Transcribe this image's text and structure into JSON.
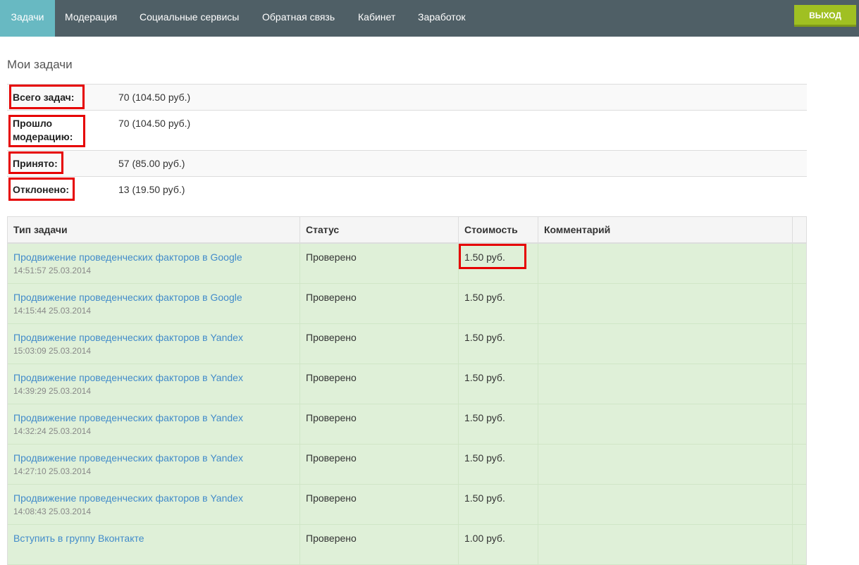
{
  "nav": {
    "items": [
      {
        "label": "Задачи",
        "active": true
      },
      {
        "label": "Модерация",
        "active": false
      },
      {
        "label": "Социальные сервисы",
        "active": false
      },
      {
        "label": "Обратная связь",
        "active": false
      },
      {
        "label": "Кабинет",
        "active": false
      },
      {
        "label": "Заработок",
        "active": false
      }
    ],
    "logout_label": "Выход"
  },
  "page": {
    "title": "Мои задачи"
  },
  "summary": {
    "total": {
      "label": "Всего задач:",
      "value": "70 (104.50 руб.)"
    },
    "moderated": {
      "label": "Прошло модерацию:",
      "value": "70 (104.50 руб.)"
    },
    "accepted": {
      "label": "Принято:",
      "value": "57 (85.00 руб.)"
    },
    "rejected": {
      "label": "Отклонено:",
      "value": "13 (19.50 руб.)"
    }
  },
  "table": {
    "headers": [
      "Тип задачи",
      "Статус",
      "Стоимость",
      "Комментарий"
    ],
    "rows": [
      {
        "task": "Продвижение проведенческих факторов в Google",
        "time": "14:51:57 25.03.2014",
        "status": "Проверено",
        "cost": "1.50 руб.",
        "comment": ""
      },
      {
        "task": "Продвижение проведенческих факторов в Google",
        "time": "14:15:44 25.03.2014",
        "status": "Проверено",
        "cost": "1.50 руб.",
        "comment": ""
      },
      {
        "task": "Продвижение проведенческих факторов в Yandex",
        "time": "15:03:09 25.03.2014",
        "status": "Проверено",
        "cost": "1.50 руб.",
        "comment": ""
      },
      {
        "task": "Продвижение проведенческих факторов в Yandex",
        "time": "14:39:29 25.03.2014",
        "status": "Проверено",
        "cost": "1.50 руб.",
        "comment": ""
      },
      {
        "task": "Продвижение проведенческих факторов в Yandex",
        "time": "14:32:24 25.03.2014",
        "status": "Проверено",
        "cost": "1.50 руб.",
        "comment": ""
      },
      {
        "task": "Продвижение проведенческих факторов в Yandex",
        "time": "14:27:10 25.03.2014",
        "status": "Проверено",
        "cost": "1.50 руб.",
        "comment": ""
      },
      {
        "task": "Продвижение проведенческих факторов в Yandex",
        "time": "14:08:43 25.03.2014",
        "status": "Проверено",
        "cost": "1.50 руб.",
        "comment": ""
      },
      {
        "task": "Вступить в группу Вконтакте",
        "time": "",
        "status": "Проверено",
        "cost": "1.00 руб.",
        "comment": ""
      }
    ]
  },
  "colors": {
    "navbar_bg": "#4f5f66",
    "nav_active_bg": "#68b9c2",
    "logout_bg": "#a0c022",
    "row_success_bg": "#dff0d8",
    "link": "#428bca",
    "highlight": "#e60000"
  }
}
